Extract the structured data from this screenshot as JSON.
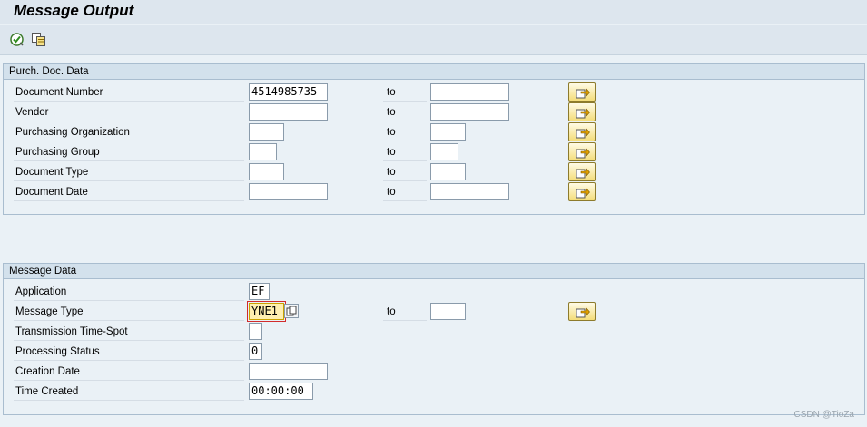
{
  "header": {
    "title": "Message Output"
  },
  "toolbar": {
    "execute_icon": "execute-icon",
    "multi_select_icon": "copy-icon"
  },
  "purch_doc": {
    "title": "Purch. Doc. Data",
    "to_label": "to",
    "rows": [
      {
        "label": "Document Number",
        "low": "4514985735",
        "high": ""
      },
      {
        "label": "Vendor",
        "low": "",
        "high": ""
      },
      {
        "label": "Purchasing Organization",
        "low": "",
        "high": ""
      },
      {
        "label": "Purchasing Group",
        "low": "",
        "high": ""
      },
      {
        "label": "Document Type",
        "low": "",
        "high": ""
      },
      {
        "label": "Document Date",
        "low": "",
        "high": ""
      }
    ]
  },
  "message": {
    "title": "Message Data",
    "to_label": "to",
    "rows": [
      {
        "label": "Application",
        "value": "EF"
      },
      {
        "label": "Message Type",
        "value": "YNE1",
        "high": ""
      },
      {
        "label": "Transmission Time-Spot",
        "value": ""
      },
      {
        "label": "Processing Status",
        "value": "0"
      },
      {
        "label": "Creation Date",
        "value": ""
      },
      {
        "label": "Time Created",
        "value": "00:00:00"
      }
    ]
  },
  "footer": {
    "watermark": "CSDN @TioZa"
  }
}
